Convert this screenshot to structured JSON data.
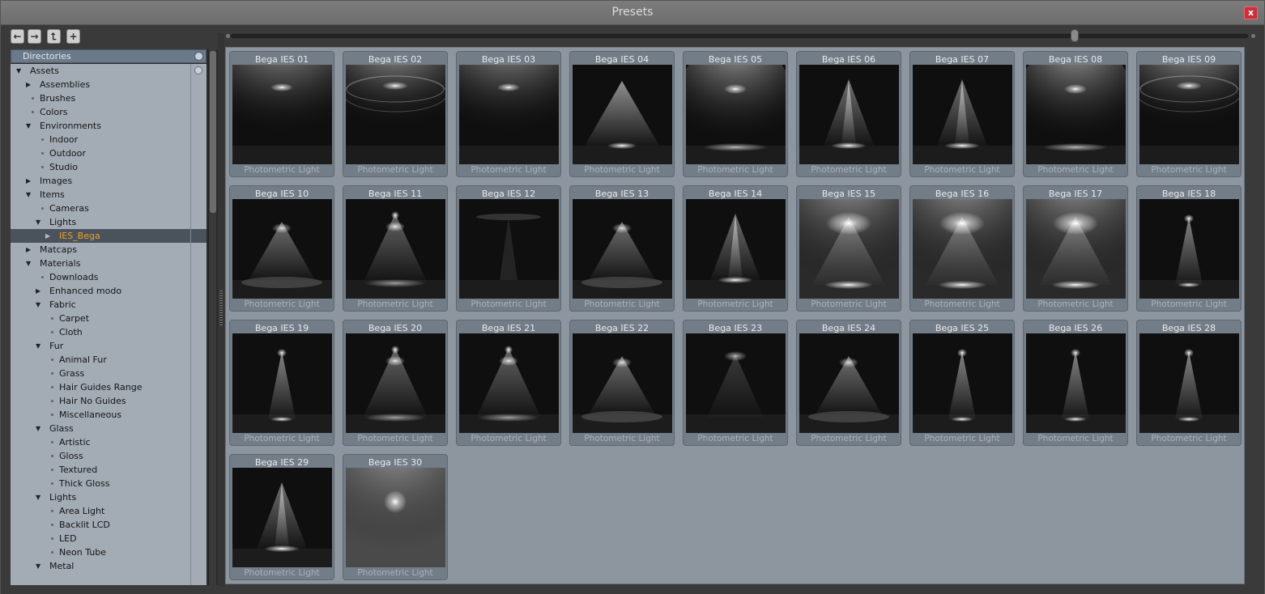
{
  "window": {
    "title": "Presets",
    "close_label": "x"
  },
  "toolbar": {
    "back": "←",
    "forward": "→",
    "up": "⮤",
    "add": "+"
  },
  "sidebar": {
    "header": "Directories",
    "tree": [
      {
        "label": "Assets",
        "depth": 0,
        "expand": "open"
      },
      {
        "label": "Assemblies",
        "depth": 1,
        "expand": "closed"
      },
      {
        "label": "Brushes",
        "depth": 1,
        "expand": "leaf"
      },
      {
        "label": "Colors",
        "depth": 1,
        "expand": "leaf"
      },
      {
        "label": "Environments",
        "depth": 1,
        "expand": "open"
      },
      {
        "label": "Indoor",
        "depth": 2,
        "expand": "leaf"
      },
      {
        "label": "Outdoor",
        "depth": 2,
        "expand": "leaf"
      },
      {
        "label": "Studio",
        "depth": 2,
        "expand": "leaf"
      },
      {
        "label": "Images",
        "depth": 1,
        "expand": "closed"
      },
      {
        "label": "Items",
        "depth": 1,
        "expand": "open"
      },
      {
        "label": "Cameras",
        "depth": 2,
        "expand": "leaf"
      },
      {
        "label": "Lights",
        "depth": 2,
        "expand": "open"
      },
      {
        "label": "IES_Bega",
        "depth": 3,
        "expand": "closed",
        "selected": true
      },
      {
        "label": "Matcaps",
        "depth": 1,
        "expand": "closed"
      },
      {
        "label": "Materials",
        "depth": 1,
        "expand": "open"
      },
      {
        "label": "Downloads",
        "depth": 2,
        "expand": "leaf"
      },
      {
        "label": "Enhanced modo",
        "depth": 2,
        "expand": "closed"
      },
      {
        "label": "Fabric",
        "depth": 2,
        "expand": "open"
      },
      {
        "label": "Carpet",
        "depth": 3,
        "expand": "leaf"
      },
      {
        "label": "Cloth",
        "depth": 3,
        "expand": "leaf"
      },
      {
        "label": "Fur",
        "depth": 2,
        "expand": "open"
      },
      {
        "label": "Animal Fur",
        "depth": 3,
        "expand": "leaf"
      },
      {
        "label": "Grass",
        "depth": 3,
        "expand": "leaf"
      },
      {
        "label": "Hair Guides Range",
        "depth": 3,
        "expand": "leaf"
      },
      {
        "label": "Hair No Guides",
        "depth": 3,
        "expand": "leaf"
      },
      {
        "label": "Miscellaneous",
        "depth": 3,
        "expand": "leaf"
      },
      {
        "label": "Glass",
        "depth": 2,
        "expand": "open"
      },
      {
        "label": "Artistic",
        "depth": 3,
        "expand": "leaf"
      },
      {
        "label": "Gloss",
        "depth": 3,
        "expand": "leaf"
      },
      {
        "label": "Textured",
        "depth": 3,
        "expand": "leaf"
      },
      {
        "label": "Thick Gloss",
        "depth": 3,
        "expand": "leaf"
      },
      {
        "label": "Lights",
        "depth": 2,
        "expand": "open"
      },
      {
        "label": "Area Light",
        "depth": 3,
        "expand": "leaf"
      },
      {
        "label": "Backlit LCD",
        "depth": 3,
        "expand": "leaf"
      },
      {
        "label": "LED",
        "depth": 3,
        "expand": "leaf"
      },
      {
        "label": "Neon Tube",
        "depth": 3,
        "expand": "leaf"
      },
      {
        "label": "Metal",
        "depth": 2,
        "expand": "open"
      }
    ]
  },
  "zoom": {
    "level": 0.83
  },
  "presets": [
    {
      "name": "Bega IES 01",
      "sub": "Photometric Light",
      "style": "wide"
    },
    {
      "name": "Bega IES 02",
      "sub": "Photometric Light",
      "style": "rings"
    },
    {
      "name": "Bega IES 03",
      "sub": "Photometric Light",
      "style": "wide"
    },
    {
      "name": "Bega IES 04",
      "sub": "Photometric Light",
      "style": "floor"
    },
    {
      "name": "Bega IES 05",
      "sub": "Photometric Light",
      "style": "soft"
    },
    {
      "name": "Bega IES 06",
      "sub": "Photometric Light",
      "style": "beam"
    },
    {
      "name": "Bega IES 07",
      "sub": "Photometric Light",
      "style": "beam"
    },
    {
      "name": "Bega IES 08",
      "sub": "Photometric Light",
      "style": "soft"
    },
    {
      "name": "Bega IES 09",
      "sub": "Photometric Light",
      "style": "rings"
    },
    {
      "name": "Bega IES 10",
      "sub": "Photometric Light",
      "style": "cone"
    },
    {
      "name": "Bega IES 11",
      "sub": "Photometric Light",
      "style": "double"
    },
    {
      "name": "Bega IES 12",
      "sub": "Photometric Light",
      "style": "dark"
    },
    {
      "name": "Bega IES 13",
      "sub": "Photometric Light",
      "style": "cone"
    },
    {
      "name": "Bega IES 14",
      "sub": "Photometric Light",
      "style": "beam"
    },
    {
      "name": "Bega IES 15",
      "sub": "Photometric Light",
      "style": "bright"
    },
    {
      "name": "Bega IES 16",
      "sub": "Photometric Light",
      "style": "bright"
    },
    {
      "name": "Bega IES 17",
      "sub": "Photometric Light",
      "style": "bright"
    },
    {
      "name": "Bega IES 18",
      "sub": "Photometric Light",
      "style": "narrow"
    },
    {
      "name": "Bega IES 19",
      "sub": "Photometric Light",
      "style": "narrow"
    },
    {
      "name": "Bega IES 20",
      "sub": "Photometric Light",
      "style": "double"
    },
    {
      "name": "Bega IES 21",
      "sub": "Photometric Light",
      "style": "double"
    },
    {
      "name": "Bega IES 22",
      "sub": "Photometric Light",
      "style": "cone"
    },
    {
      "name": "Bega IES 23",
      "sub": "Photometric Light",
      "style": "dim"
    },
    {
      "name": "Bega IES 24",
      "sub": "Photometric Light",
      "style": "cone"
    },
    {
      "name": "Bega IES 25",
      "sub": "Photometric Light",
      "style": "narrow"
    },
    {
      "name": "Bega IES 26",
      "sub": "Photometric Light",
      "style": "narrow"
    },
    {
      "name": "Bega IES 28",
      "sub": "Photometric Light",
      "style": "narrow"
    },
    {
      "name": "Bega IES 29",
      "sub": "Photometric Light",
      "style": "beam"
    },
    {
      "name": "Bega IES 30",
      "sub": "Photometric Light",
      "style": "point"
    }
  ]
}
